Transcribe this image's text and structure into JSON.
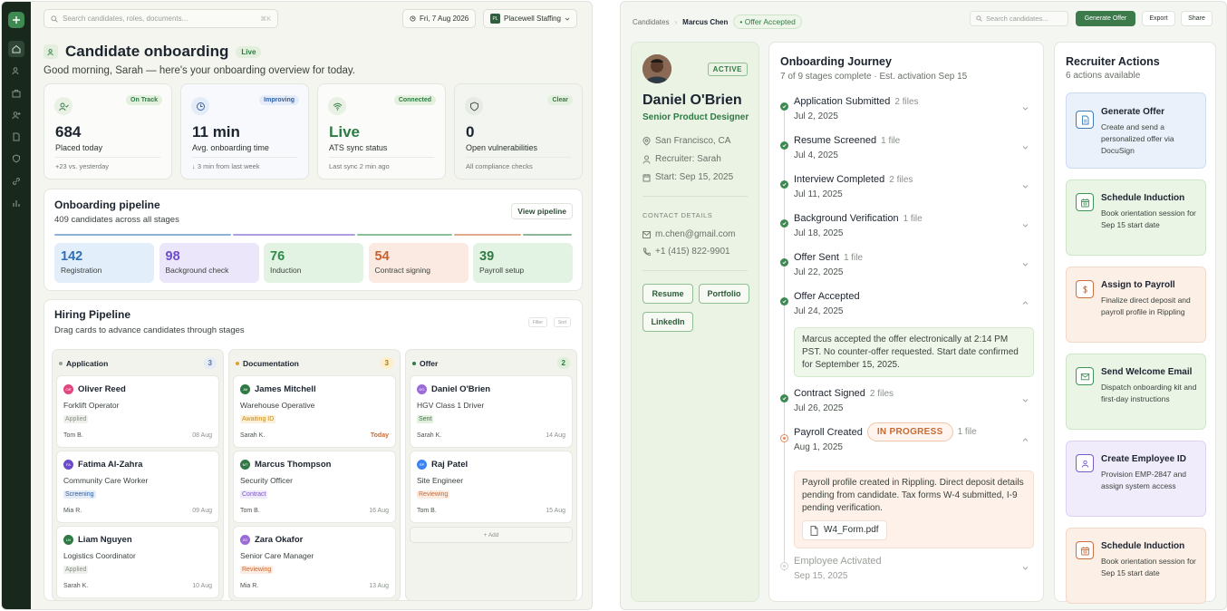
{
  "left": {
    "search_placeholder": "Search candidates, roles, documents...",
    "search_kbd": "⌘K",
    "date": "Fri, 7 Aug 2026",
    "org_initials": "PL",
    "org": "Placewell Staffing",
    "title": "Candidate onboarding",
    "title_badge": "Live",
    "greeting": "Good morning, Sarah — here's your onboarding overview for today.",
    "stats": [
      {
        "tag": "On Track",
        "value": "684",
        "label": "Placed today",
        "foot": "+23 vs. yesterday",
        "icon": "user-check-icon"
      },
      {
        "tag": "Improving",
        "value": "11 min",
        "label": "Avg. onboarding time",
        "foot": "↓ 3 min from last week",
        "icon": "clock-icon"
      },
      {
        "tag": "Connected",
        "value": "Live",
        "label": "ATS sync status",
        "foot": "Last sync 2 min ago",
        "icon": "wifi-icon"
      },
      {
        "tag": "Clear",
        "value": "0",
        "label": "Open vulnerabilities",
        "foot": "All compliance checks",
        "icon": "shield-icon"
      }
    ],
    "onboarding": {
      "title": "Onboarding pipeline",
      "subtitle": "409 candidates across all stages",
      "view_button": "View pipeline",
      "stages": [
        {
          "count": "142",
          "label": "Registration",
          "color": "#2f6fb5"
        },
        {
          "count": "98",
          "label": "Background check",
          "color": "#6c4cc8"
        },
        {
          "count": "76",
          "label": "Induction",
          "color": "#2f8a4a"
        },
        {
          "count": "54",
          "label": "Contract signing",
          "color": "#c8622f"
        },
        {
          "count": "39",
          "label": "Payroll setup",
          "color": "#2f7a44"
        }
      ]
    },
    "hiring": {
      "title": "Hiring Pipeline",
      "subtitle": "Drag cards to advance candidates through stages",
      "filter": "Filter",
      "sort": "Sort",
      "add": "+ Add",
      "columns": [
        {
          "name": "Application",
          "count": "3",
          "cards": [
            {
              "initials": "OR",
              "name": "Oliver Reed",
              "role": "Forklift Operator",
              "status": "Applied",
              "recruiter": "Tom B.",
              "date": "08 Aug"
            },
            {
              "initials": "FA",
              "name": "Fatima Al-Zahra",
              "role": "Community Care Worker",
              "status": "Screening",
              "recruiter": "Mia R.",
              "date": "09 Aug"
            },
            {
              "initials": "LN",
              "name": "Liam Nguyen",
              "role": "Logistics Coordinator",
              "status": "Applied",
              "recruiter": "Sarah K.",
              "date": "10 Aug"
            }
          ]
        },
        {
          "name": "Documentation",
          "count": "3",
          "cards": [
            {
              "initials": "JM",
              "name": "James Mitchell",
              "role": "Warehouse Operative",
              "status": "Awaiting ID",
              "recruiter": "Sarah K.",
              "date": "Today"
            },
            {
              "initials": "MT",
              "name": "Marcus Thompson",
              "role": "Security Officer",
              "status": "Contract",
              "recruiter": "Tom B.",
              "date": "16 Aug"
            },
            {
              "initials": "ZO",
              "name": "Zara Okafor",
              "role": "Senior Care Manager",
              "status": "Reviewing",
              "recruiter": "Mia R.",
              "date": "13 Aug"
            }
          ]
        },
        {
          "name": "Offer",
          "count": "2",
          "cards": [
            {
              "initials": "DO",
              "name": "Daniel O'Brien",
              "role": "HGV Class 1 Driver",
              "status": "Sent",
              "recruiter": "Sarah K.",
              "date": "14 Aug"
            },
            {
              "initials": "RP",
              "name": "Raj Patel",
              "role": "Site Engineer",
              "status": "Reviewing",
              "recruiter": "Tom B.",
              "date": "15 Aug"
            }
          ]
        }
      ]
    }
  },
  "right": {
    "breadcrumb_root": "Candidates",
    "breadcrumb_current": "Marcus Chen",
    "status_pill": "• Offer Accepted",
    "search_placeholder": "Search candidates...",
    "generate_offer": "Generate Offer",
    "export": "Export",
    "share": "Share",
    "profile": {
      "status": "ACTIVE",
      "name": "Daniel O'Brien",
      "role": "Senior Product Designer",
      "location": "San Francisco, CA",
      "recruiter": "Recruiter: Sarah",
      "start": "Start: Sep 15, 2025",
      "contact_label": "CONTACT DETAILS",
      "email": "m.chen@gmail.com",
      "phone": "+1 (415) 822-9901",
      "buttons": [
        "Resume",
        "Portfolio",
        "LinkedIn"
      ]
    },
    "journey": {
      "title": "Onboarding Journey",
      "subtitle": "7 of 9 stages complete · Est. activation Sep 15",
      "steps": [
        {
          "name": "Application Submitted",
          "files": "2 files",
          "date": "Jul 2, 2025",
          "state": "done"
        },
        {
          "name": "Resume Screened",
          "files": "1 file",
          "date": "Jul 4, 2025",
          "state": "done"
        },
        {
          "name": "Interview Completed",
          "files": "2 files",
          "date": "Jul 11, 2025",
          "state": "done"
        },
        {
          "name": "Background Verification",
          "files": "1 file",
          "date": "Jul 18, 2025",
          "state": "done"
        },
        {
          "name": "Offer Sent",
          "files": "1 file",
          "date": "Jul 22, 2025",
          "state": "done"
        },
        {
          "name": "Offer Accepted",
          "files": "",
          "date": "Jul 24, 2025",
          "state": "done"
        },
        {
          "name": "Contract Signed",
          "files": "2 files",
          "date": "Jul 26, 2025",
          "state": "done"
        },
        {
          "name": "Payroll Created",
          "files": "1 file",
          "date": "Aug 1, 2025",
          "state": "progress"
        },
        {
          "name": "Employee Activated",
          "files": "",
          "date": "Sep 15, 2025",
          "state": "pending"
        }
      ],
      "offer_note": "Marcus accepted the offer electronically at 2:14 PM PST. No counter-offer requested. Start date confirmed for September 15, 2025.",
      "in_progress": "IN PROGRESS",
      "payroll_note": "Payroll profile created in Rippling. Direct deposit details pending from candidate. Tax forms W-4 submitted, I-9 pending verification.",
      "file_name": "W4_Form.pdf"
    },
    "actions": {
      "title": "Recruiter Actions",
      "subtitle": "6 actions available",
      "items": [
        {
          "title": "Generate Offer",
          "desc": "Create and send a personalized offer via DocuSign",
          "color": "#2f6fb5",
          "icon": "document-icon"
        },
        {
          "title": "Schedule Induction",
          "desc": "Book orientation session for Sep 15 start date",
          "color": "#2f8a4a",
          "icon": "calendar-icon"
        },
        {
          "title": "Assign to Payroll",
          "desc": "Finalize direct deposit and payroll profile in Rippling",
          "color": "#c8622f",
          "icon": "dollar-icon"
        },
        {
          "title": "Send Welcome Email",
          "desc": "Dispatch onboarding kit and first-day instructions",
          "color": "#2f8a4a",
          "icon": "mail-icon"
        },
        {
          "title": "Create Employee ID",
          "desc": "Provision EMP-2847 and assign system access",
          "color": "#6c4cc8",
          "icon": "id-badge-icon"
        },
        {
          "title": "Schedule Induction",
          "desc": "Book orientation session for Sep 15 start date",
          "color": "#c8622f",
          "icon": "calendar-icon"
        }
      ]
    }
  }
}
